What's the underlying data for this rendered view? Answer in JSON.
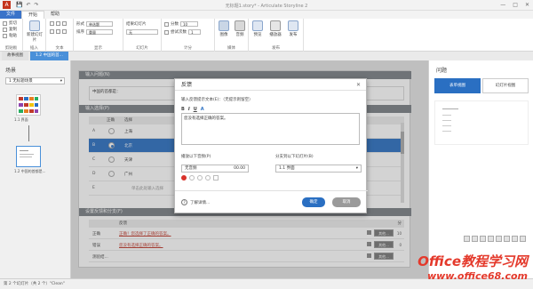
{
  "titlebar": {
    "app_icon": "A",
    "title": "无标题1.story* - Articulate Storyline 2",
    "quick_access": [
      "💾",
      "↶",
      "↷"
    ],
    "window_controls": [
      "—",
      "□",
      "✕"
    ]
  },
  "tabs": [
    "文件",
    "开始",
    "帮助"
  ],
  "ribbon": {
    "clipboard": {
      "items": [
        "剪切",
        "复制",
        "粘贴"
      ],
      "label": "剪贴板"
    },
    "insert": {
      "new_slide": "新建幻灯片",
      "label": "插入"
    },
    "text": {
      "label": "文本"
    },
    "layout": {
      "form_label": "形式",
      "form_value": "单选题",
      "score_label": "排序",
      "score_value": "重量",
      "label": "显示"
    },
    "slide": {
      "after_label": "结果幻灯片",
      "after_value": "无",
      "label": "幻灯片"
    },
    "score": {
      "score_label": "分数",
      "score_value": "10",
      "attempts_label": "尝试次数",
      "attempts_value": "1",
      "label": "计分"
    },
    "publish": {
      "preview": "预览",
      "player": "播放器",
      "publish": "发布",
      "label": "发布"
    },
    "media": {
      "image": "图像",
      "audio": "音频",
      "label": "媒体"
    }
  },
  "doc_tabs": [
    "故事视图",
    "1.2 中国的首..."
  ],
  "scenes": {
    "title": "场景",
    "dropdown": "1 无标题场景",
    "thumb1_caption": "1.1 界面",
    "thumb2_caption": "1.2 中国的首都是..."
  },
  "slide": {
    "question_header": "输入问题(N)",
    "question_text": "中国的首都是：",
    "choices_header": "输入选择(P)",
    "col_correct": "正确",
    "col_choice": "选择",
    "choices": [
      {
        "letter": "A",
        "text": "上海"
      },
      {
        "letter": "B",
        "text": "北京"
      },
      {
        "letter": "C",
        "text": "天津"
      },
      {
        "letter": "D",
        "text": "广州"
      },
      {
        "letter": "E",
        "text": "单击此处输入选择"
      }
    ],
    "feedback_header": "设置反馈和分支(F)",
    "feedback_col": "反馈",
    "feedback_col_score": "分",
    "feedback": [
      {
        "label": "正确",
        "text": "正确！您选择了正确的答案。",
        "btn": "其他...",
        "num": "10"
      },
      {
        "label": "错误",
        "text": "您没有选择正确的答案。",
        "btn": "其他...",
        "num": "0"
      },
      {
        "label": "测验结...",
        "text": "",
        "btn": "其他...",
        "num": ""
      }
    ]
  },
  "right_panel": {
    "title": "问题",
    "tab_form": "表单视图",
    "tab_slide": "幻灯片视图"
  },
  "dialog": {
    "title": "反馈",
    "close": "✕",
    "label_text": "输入反馈提示文本(E)：（无提示则留空）",
    "format_buttons": [
      "B",
      "I",
      "U",
      "A"
    ],
    "text": "您没有选择正确的答案。",
    "label_audio": "播放以下音频(P)",
    "audio_value": "无音频",
    "audio_time": "00.00",
    "label_branch": "分支到以下幻灯片(B)",
    "branch_value": "1.1 界面",
    "help": "了解详情...",
    "ok": "确定",
    "cancel": "取消"
  },
  "status": "第 2 个幻灯片（共 2 个）\"Clean\"",
  "watermark": {
    "line1": "Office教程学习网",
    "line2": "www.office68.com"
  },
  "colors": {
    "accent": "#2a6fc2",
    "file_tab": "#3a73c9",
    "record": "#d9332b",
    "watermark": "#e4392b"
  }
}
